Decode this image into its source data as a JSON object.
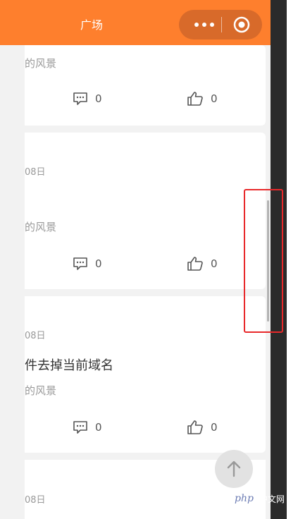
{
  "header": {
    "title": "广场"
  },
  "icons": {
    "more": "more-dots-icon",
    "target": "target-circle-icon",
    "comment": "comment-icon",
    "like": "thumbs-up-icon",
    "to_top": "arrow-up-icon"
  },
  "cards": [
    {
      "desc": "的风景",
      "comments": "0",
      "likes": "0"
    },
    {
      "date": "08日",
      "desc": "的风景",
      "comments": "0",
      "likes": "0"
    },
    {
      "date": "08日",
      "title": "件去掉当前域名",
      "desc": "的风景",
      "comments": "0",
      "likes": "0"
    },
    {
      "date": "08日"
    }
  ],
  "watermark": {
    "logo": "php",
    "text": "中文网"
  },
  "colors": {
    "header_bg": "#fe7f2d",
    "capsule_bg": "#d86a2a",
    "page_bg": "#f2f2f2",
    "highlight_border": "#e8292b",
    "dark_strip": "#2b2b2b"
  }
}
